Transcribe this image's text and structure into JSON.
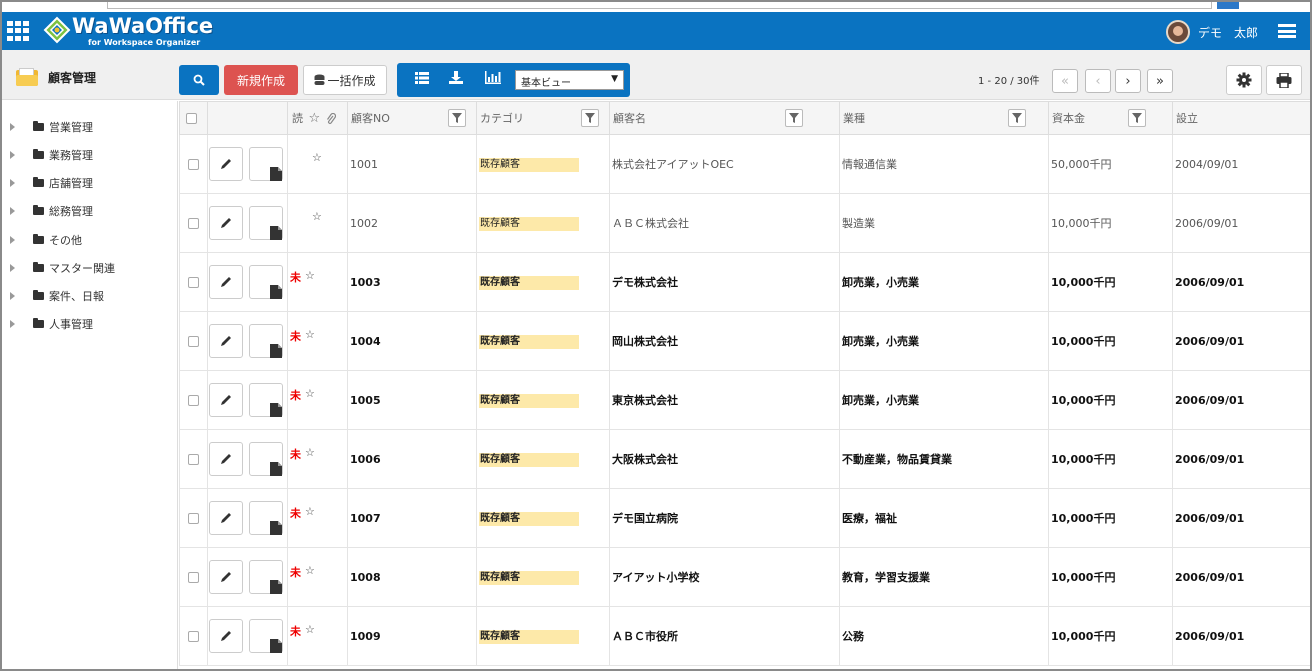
{
  "header": {
    "logo_name": "WaWaOffice",
    "logo_sub": "for Workspace Organizer",
    "user_name": "デモ　太郎"
  },
  "toolbar": {
    "module_title": "顧客管理",
    "new_label": "新規作成",
    "bulk_label": "一括作成",
    "view_select": "基本ビュー",
    "page_range": "1 - 20 / 30件"
  },
  "sidebar": {
    "items": [
      {
        "label": "営業管理"
      },
      {
        "label": "業務管理"
      },
      {
        "label": "店舗管理"
      },
      {
        "label": "総務管理"
      },
      {
        "label": "その他"
      },
      {
        "label": "マスター関連"
      },
      {
        "label": "案件、日報"
      },
      {
        "label": "人事管理"
      }
    ]
  },
  "table": {
    "columns": {
      "read": "読",
      "no": "顧客NO",
      "category": "カテゴリ",
      "name": "顧客名",
      "industry": "業種",
      "capital": "資本金",
      "established": "設立"
    },
    "unread_mark": "未",
    "star": "☆",
    "rows": [
      {
        "no": "1001",
        "category": "既存顧客",
        "name": "株式会社アイアットOEC",
        "industry": "情報通信業",
        "capital": "50,000千円",
        "established": "2004/09/01",
        "unread": false
      },
      {
        "no": "1002",
        "category": "既存顧客",
        "name": "ＡＢＣ株式会社",
        "industry": "製造業",
        "capital": "10,000千円",
        "established": "2006/09/01",
        "unread": false
      },
      {
        "no": "1003",
        "category": "既存顧客",
        "name": "デモ株式会社",
        "industry": "卸売業，小売業",
        "capital": "10,000千円",
        "established": "2006/09/01",
        "unread": true
      },
      {
        "no": "1004",
        "category": "既存顧客",
        "name": "岡山株式会社",
        "industry": "卸売業，小売業",
        "capital": "10,000千円",
        "established": "2006/09/01",
        "unread": true
      },
      {
        "no": "1005",
        "category": "既存顧客",
        "name": "東京株式会社",
        "industry": "卸売業，小売業",
        "capital": "10,000千円",
        "established": "2006/09/01",
        "unread": true
      },
      {
        "no": "1006",
        "category": "既存顧客",
        "name": "大阪株式会社",
        "industry": "不動産業，物品賃貸業",
        "capital": "10,000千円",
        "established": "2006/09/01",
        "unread": true
      },
      {
        "no": "1007",
        "category": "既存顧客",
        "name": "デモ国立病院",
        "industry": "医療，福祉",
        "capital": "10,000千円",
        "established": "2006/09/01",
        "unread": true
      },
      {
        "no": "1008",
        "category": "既存顧客",
        "name": "アイアット小学校",
        "industry": "教育，学習支援業",
        "capital": "10,000千円",
        "established": "2006/09/01",
        "unread": true
      },
      {
        "no": "1009",
        "category": "既存顧客",
        "name": "ＡＢＣ市役所",
        "industry": "公務",
        "capital": "10,000千円",
        "established": "2006/09/01",
        "unread": true
      }
    ]
  },
  "colors": {
    "header_blue": "#0a73c1",
    "new_button_red": "#dd5350",
    "category_highlight": "#fde9a9",
    "unread_red": "#e00000"
  }
}
